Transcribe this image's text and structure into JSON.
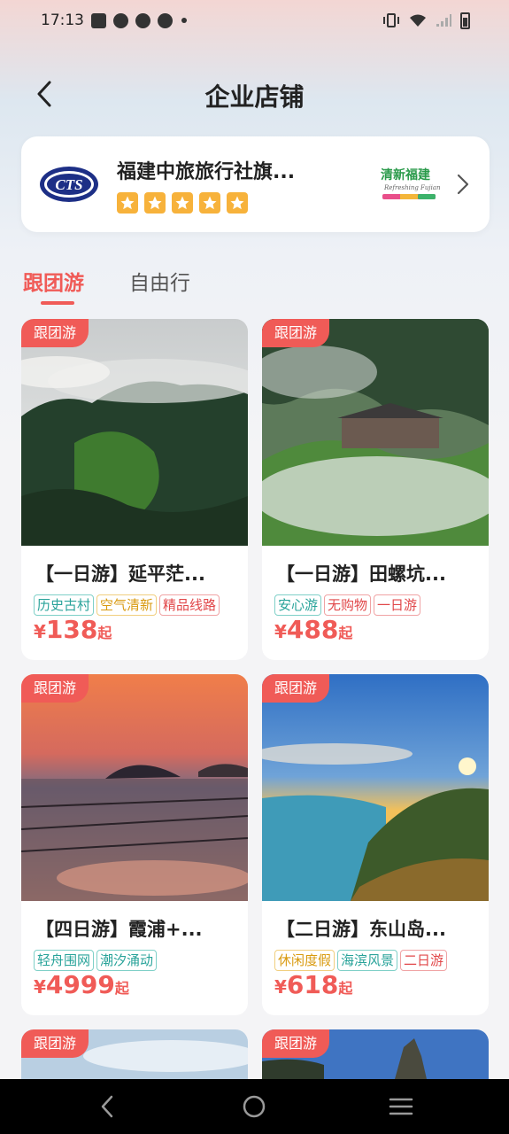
{
  "status_bar": {
    "time": "17:13"
  },
  "header": {
    "title": "企业店铺"
  },
  "store": {
    "name": "福建中旅旅行社旗...",
    "logo_text": "CTS",
    "rating_stars": 5,
    "brand_text": "清新福建",
    "brand_sub": "Refreshing Fujian"
  },
  "tabs": [
    {
      "label": "跟团游",
      "active": true
    },
    {
      "label": "自由行",
      "active": false
    }
  ],
  "products": [
    {
      "tag": "跟团游",
      "title": "【一日游】延平茫...",
      "labels": [
        {
          "text": "历史古村",
          "color": "teal"
        },
        {
          "text": "空气清新",
          "color": "gold"
        },
        {
          "text": "精品线路",
          "color": "red"
        }
      ],
      "price_symbol": "¥",
      "price": "138",
      "price_unit": "起",
      "image": "misty-green-mountains"
    },
    {
      "tag": "跟团游",
      "title": "【一日游】田螺坑...",
      "labels": [
        {
          "text": "安心游",
          "color": "teal"
        },
        {
          "text": "无购物",
          "color": "red"
        },
        {
          "text": "一日游",
          "color": "red"
        }
      ],
      "price_symbol": "¥",
      "price": "488",
      "price_unit": "起",
      "image": "village-in-mist"
    },
    {
      "tag": "跟团游",
      "title": "【四日游】霞浦+...",
      "labels": [
        {
          "text": "轻舟围网",
          "color": "teal"
        },
        {
          "text": "潮汐涌动",
          "color": "teal"
        }
      ],
      "price_symbol": "¥",
      "price": "4999",
      "price_unit": "起",
      "image": "sunset-mudflats"
    },
    {
      "tag": "跟团游",
      "title": "【二日游】东山岛...",
      "labels": [
        {
          "text": "休闲度假",
          "color": "gold"
        },
        {
          "text": "海滨风景",
          "color": "teal"
        },
        {
          "text": "二日游",
          "color": "red"
        }
      ],
      "price_symbol": "¥",
      "price": "618",
      "price_unit": "起",
      "image": "coastal-sunset-bay"
    },
    {
      "tag": "跟团游",
      "image": "sky-clouds"
    },
    {
      "tag": "跟团游",
      "image": "rock-peaks"
    }
  ],
  "colors": {
    "accent": "#f05b57",
    "star": "#f7b23b"
  }
}
